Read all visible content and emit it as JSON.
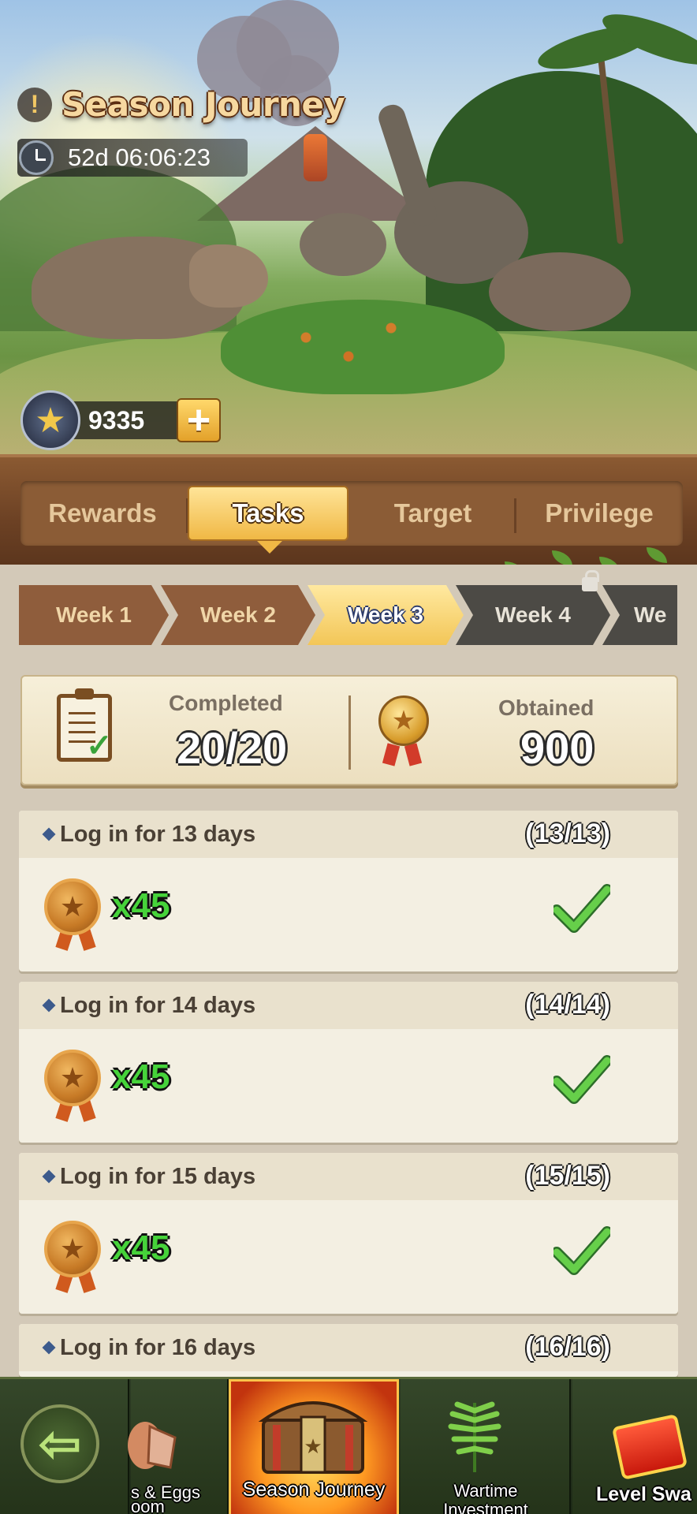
{
  "header": {
    "alert_glyph": "!",
    "title": "Season Journey",
    "timer": "52d 06:06:23",
    "points": "9335",
    "plus_glyph": "+"
  },
  "tabs": [
    {
      "label": "Rewards",
      "active": false
    },
    {
      "label": "Tasks",
      "active": true
    },
    {
      "label": "Target",
      "active": false
    },
    {
      "label": "Privilege",
      "active": false
    }
  ],
  "weeks": [
    {
      "label": "Week 1",
      "state": "done"
    },
    {
      "label": "Week 2",
      "state": "done"
    },
    {
      "label": "Week 3",
      "state": "active"
    },
    {
      "label": "Week 4",
      "state": "locked"
    },
    {
      "label": "We",
      "state": "locked"
    }
  ],
  "summary": {
    "completed_label": "Completed",
    "completed_value": "20/20",
    "obtained_label": "Obtained",
    "obtained_value": "900"
  },
  "tasks": [
    {
      "title": "Log in for 13 days",
      "progress": "(13/13)",
      "reward_qty": "x45",
      "done": true
    },
    {
      "title": "Log in for 14 days",
      "progress": "(14/14)",
      "reward_qty": "x45",
      "done": true
    },
    {
      "title": "Log in for 15 days",
      "progress": "(15/15)",
      "reward_qty": "x45",
      "done": true
    },
    {
      "title": "Log in for 16 days",
      "progress": "(16/16)"
    }
  ],
  "bottom_nav": {
    "back_glyph": "⇦",
    "eggs_label_line1": "s & Eggs",
    "eggs_label_line2": "oom",
    "season_label": "Season Journey",
    "wartime_line1": "Wartime",
    "wartime_line2": "Investment",
    "level_label": "Level Swa"
  },
  "colors": {
    "accent_gold": "#f0b845",
    "wood": "#8b5a32",
    "reward_green": "#46d33a",
    "check_green": "#3fae3f"
  }
}
